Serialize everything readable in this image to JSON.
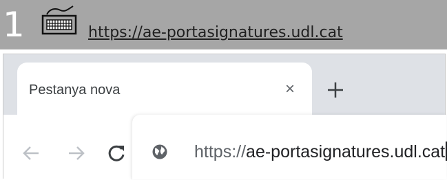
{
  "step": {
    "number": "1",
    "icon": "keyboard-icon",
    "url_text": "https://ae-portasignatures.udl.cat"
  },
  "browser": {
    "tab": {
      "title": "Pestanya nova",
      "close_glyph": "×"
    },
    "new_tab_icon": "plus-icon",
    "nav": {
      "back_icon": "arrow-left-icon",
      "forward_icon": "arrow-right-icon",
      "reload_icon": "reload-icon"
    },
    "omnibox": {
      "site_icon": "globe-icon",
      "scheme": "https://",
      "host": "ae-portasignatures.udl.cat"
    }
  },
  "colors": {
    "header_bg": "#a6a6a6",
    "tabstrip_bg": "#dee1e6",
    "icon_gray": "#5f6368"
  }
}
